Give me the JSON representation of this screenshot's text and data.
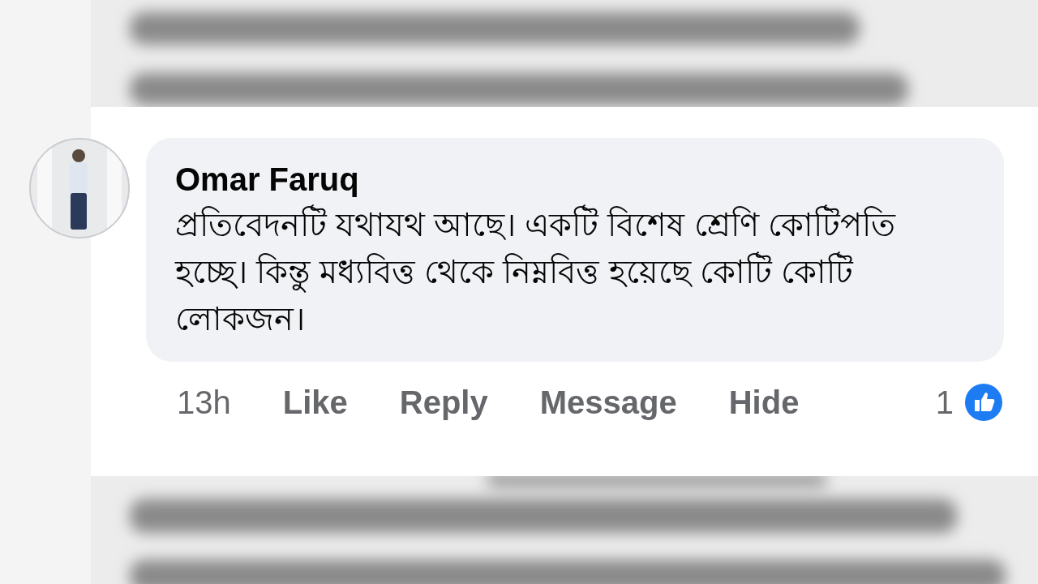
{
  "comment": {
    "author": "Omar Faruq",
    "text": "প্রতিবেদনটি যথাযথ আছে। একটি বিশেষ শ্রেণি কোটিপতি হচ্ছে। কিন্তু মধ্যবিত্ত থেকে নিম্নবিত্ত হয়েছে কোটি কোটি লোকজন।",
    "time": "13h",
    "actions": [
      "Like",
      "Reply",
      "Message",
      "Hide"
    ],
    "reaction_count": "1"
  }
}
